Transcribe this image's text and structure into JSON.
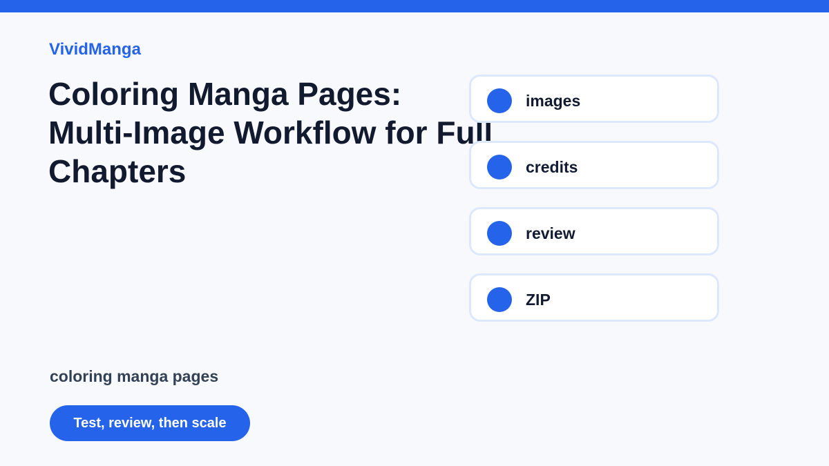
{
  "brand": "VividManga",
  "headline": "Coloring Manga Pages:\nMulti-Image Workflow for Full\nChapters",
  "features": [
    {
      "label": "images"
    },
    {
      "label": "credits"
    },
    {
      "label": "review"
    },
    {
      "label": "ZIP"
    }
  ],
  "keyword": "coloring manga pages",
  "cta": {
    "label": "Test, review, then scale"
  },
  "colors": {
    "accent": "#2563eb",
    "background": "#f7f9fc",
    "heading": "#111a2e",
    "card_border": "#dbe8fd"
  },
  "icons": {
    "feature_marker": "circle-bullet-icon"
  }
}
